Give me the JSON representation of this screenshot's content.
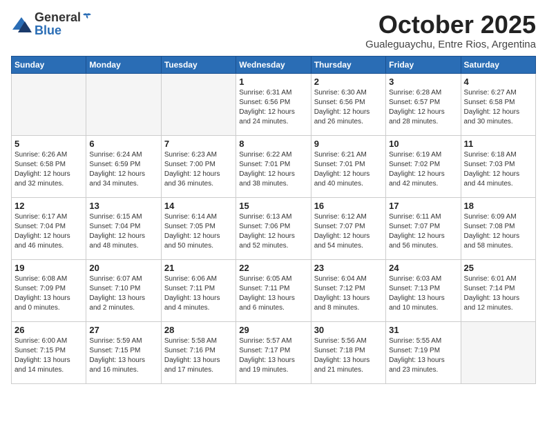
{
  "logo": {
    "general": "General",
    "blue": "Blue"
  },
  "title": "October 2025",
  "subtitle": "Gualeguaychu, Entre Rios, Argentina",
  "headers": [
    "Sunday",
    "Monday",
    "Tuesday",
    "Wednesday",
    "Thursday",
    "Friday",
    "Saturday"
  ],
  "weeks": [
    [
      {
        "day": "",
        "sunrise": "",
        "sunset": "",
        "daylight": ""
      },
      {
        "day": "",
        "sunrise": "",
        "sunset": "",
        "daylight": ""
      },
      {
        "day": "",
        "sunrise": "",
        "sunset": "",
        "daylight": ""
      },
      {
        "day": "1",
        "sunrise": "Sunrise: 6:31 AM",
        "sunset": "Sunset: 6:56 PM",
        "daylight": "Daylight: 12 hours and 24 minutes."
      },
      {
        "day": "2",
        "sunrise": "Sunrise: 6:30 AM",
        "sunset": "Sunset: 6:56 PM",
        "daylight": "Daylight: 12 hours and 26 minutes."
      },
      {
        "day": "3",
        "sunrise": "Sunrise: 6:28 AM",
        "sunset": "Sunset: 6:57 PM",
        "daylight": "Daylight: 12 hours and 28 minutes."
      },
      {
        "day": "4",
        "sunrise": "Sunrise: 6:27 AM",
        "sunset": "Sunset: 6:58 PM",
        "daylight": "Daylight: 12 hours and 30 minutes."
      }
    ],
    [
      {
        "day": "5",
        "sunrise": "Sunrise: 6:26 AM",
        "sunset": "Sunset: 6:58 PM",
        "daylight": "Daylight: 12 hours and 32 minutes."
      },
      {
        "day": "6",
        "sunrise": "Sunrise: 6:24 AM",
        "sunset": "Sunset: 6:59 PM",
        "daylight": "Daylight: 12 hours and 34 minutes."
      },
      {
        "day": "7",
        "sunrise": "Sunrise: 6:23 AM",
        "sunset": "Sunset: 7:00 PM",
        "daylight": "Daylight: 12 hours and 36 minutes."
      },
      {
        "day": "8",
        "sunrise": "Sunrise: 6:22 AM",
        "sunset": "Sunset: 7:01 PM",
        "daylight": "Daylight: 12 hours and 38 minutes."
      },
      {
        "day": "9",
        "sunrise": "Sunrise: 6:21 AM",
        "sunset": "Sunset: 7:01 PM",
        "daylight": "Daylight: 12 hours and 40 minutes."
      },
      {
        "day": "10",
        "sunrise": "Sunrise: 6:19 AM",
        "sunset": "Sunset: 7:02 PM",
        "daylight": "Daylight: 12 hours and 42 minutes."
      },
      {
        "day": "11",
        "sunrise": "Sunrise: 6:18 AM",
        "sunset": "Sunset: 7:03 PM",
        "daylight": "Daylight: 12 hours and 44 minutes."
      }
    ],
    [
      {
        "day": "12",
        "sunrise": "Sunrise: 6:17 AM",
        "sunset": "Sunset: 7:04 PM",
        "daylight": "Daylight: 12 hours and 46 minutes."
      },
      {
        "day": "13",
        "sunrise": "Sunrise: 6:15 AM",
        "sunset": "Sunset: 7:04 PM",
        "daylight": "Daylight: 12 hours and 48 minutes."
      },
      {
        "day": "14",
        "sunrise": "Sunrise: 6:14 AM",
        "sunset": "Sunset: 7:05 PM",
        "daylight": "Daylight: 12 hours and 50 minutes."
      },
      {
        "day": "15",
        "sunrise": "Sunrise: 6:13 AM",
        "sunset": "Sunset: 7:06 PM",
        "daylight": "Daylight: 12 hours and 52 minutes."
      },
      {
        "day": "16",
        "sunrise": "Sunrise: 6:12 AM",
        "sunset": "Sunset: 7:07 PM",
        "daylight": "Daylight: 12 hours and 54 minutes."
      },
      {
        "day": "17",
        "sunrise": "Sunrise: 6:11 AM",
        "sunset": "Sunset: 7:07 PM",
        "daylight": "Daylight: 12 hours and 56 minutes."
      },
      {
        "day": "18",
        "sunrise": "Sunrise: 6:09 AM",
        "sunset": "Sunset: 7:08 PM",
        "daylight": "Daylight: 12 hours and 58 minutes."
      }
    ],
    [
      {
        "day": "19",
        "sunrise": "Sunrise: 6:08 AM",
        "sunset": "Sunset: 7:09 PM",
        "daylight": "Daylight: 13 hours and 0 minutes."
      },
      {
        "day": "20",
        "sunrise": "Sunrise: 6:07 AM",
        "sunset": "Sunset: 7:10 PM",
        "daylight": "Daylight: 13 hours and 2 minutes."
      },
      {
        "day": "21",
        "sunrise": "Sunrise: 6:06 AM",
        "sunset": "Sunset: 7:11 PM",
        "daylight": "Daylight: 13 hours and 4 minutes."
      },
      {
        "day": "22",
        "sunrise": "Sunrise: 6:05 AM",
        "sunset": "Sunset: 7:11 PM",
        "daylight": "Daylight: 13 hours and 6 minutes."
      },
      {
        "day": "23",
        "sunrise": "Sunrise: 6:04 AM",
        "sunset": "Sunset: 7:12 PM",
        "daylight": "Daylight: 13 hours and 8 minutes."
      },
      {
        "day": "24",
        "sunrise": "Sunrise: 6:03 AM",
        "sunset": "Sunset: 7:13 PM",
        "daylight": "Daylight: 13 hours and 10 minutes."
      },
      {
        "day": "25",
        "sunrise": "Sunrise: 6:01 AM",
        "sunset": "Sunset: 7:14 PM",
        "daylight": "Daylight: 13 hours and 12 minutes."
      }
    ],
    [
      {
        "day": "26",
        "sunrise": "Sunrise: 6:00 AM",
        "sunset": "Sunset: 7:15 PM",
        "daylight": "Daylight: 13 hours and 14 minutes."
      },
      {
        "day": "27",
        "sunrise": "Sunrise: 5:59 AM",
        "sunset": "Sunset: 7:15 PM",
        "daylight": "Daylight: 13 hours and 16 minutes."
      },
      {
        "day": "28",
        "sunrise": "Sunrise: 5:58 AM",
        "sunset": "Sunset: 7:16 PM",
        "daylight": "Daylight: 13 hours and 17 minutes."
      },
      {
        "day": "29",
        "sunrise": "Sunrise: 5:57 AM",
        "sunset": "Sunset: 7:17 PM",
        "daylight": "Daylight: 13 hours and 19 minutes."
      },
      {
        "day": "30",
        "sunrise": "Sunrise: 5:56 AM",
        "sunset": "Sunset: 7:18 PM",
        "daylight": "Daylight: 13 hours and 21 minutes."
      },
      {
        "day": "31",
        "sunrise": "Sunrise: 5:55 AM",
        "sunset": "Sunset: 7:19 PM",
        "daylight": "Daylight: 13 hours and 23 minutes."
      },
      {
        "day": "",
        "sunrise": "",
        "sunset": "",
        "daylight": ""
      }
    ]
  ]
}
